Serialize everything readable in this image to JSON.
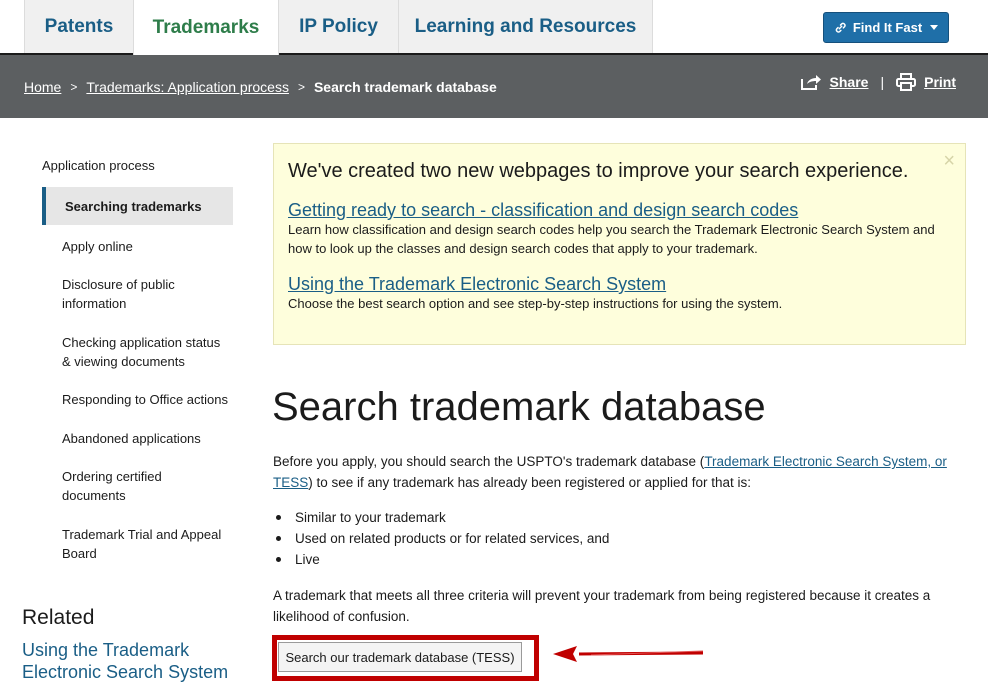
{
  "topnav": {
    "tabs": [
      {
        "label": "Patents"
      },
      {
        "label": "Trademarks"
      },
      {
        "label": "IP Policy"
      },
      {
        "label": "Learning and Resources"
      }
    ],
    "find_it_fast": "Find It Fast",
    "colors": {
      "active_tab": "#2e7d4a",
      "tab_text": "#1a5e86",
      "button": "#1f6fa8"
    }
  },
  "breadcrumb": {
    "items": [
      "Home",
      "Trademarks: Application process"
    ],
    "current": "Search trademark database",
    "share": "Share",
    "print": "Print",
    "divider": "|"
  },
  "sidebar": {
    "heading": "Application process",
    "active": "Searching trademarks",
    "items": [
      {
        "label": "Apply online"
      },
      {
        "label": "Disclosure of public information"
      },
      {
        "label": "Checking application status & viewing documents"
      },
      {
        "label": "Responding to Office actions"
      },
      {
        "label": "Abandoned applications"
      },
      {
        "label": "Ordering certified documents"
      },
      {
        "label": "Trademark Trial and Appeal Board"
      }
    ],
    "related_heading": "Related",
    "related_link": "Using the Trademark Electronic Search System"
  },
  "notice": {
    "title": "We've created two new webpages to improve your search experience.",
    "link1": "Getting ready to search - classification and design search codes",
    "text1": "Learn how classification and design search codes help you search the Trademark Electronic Search System and how to look up the classes and design search codes that apply to your trademark.",
    "link2": "Using the Trademark Electronic Search System",
    "text2": "Choose the best search option and see step-by-step instructions for using the system.",
    "close": "×"
  },
  "main": {
    "title": "Search trademark database",
    "intro_before": "Before you apply, you should search the USPTO's trademark database (",
    "intro_link": "Trademark Electronic Search System, or TESS",
    "intro_after": ") to see if any trademark has already been registered or applied for that is:",
    "bullets": [
      "Similar to your trademark",
      "Used on related products or for related services, and",
      "Live"
    ],
    "para2": "A trademark that meets all three criteria will prevent your trademark from being registered because it creates a likelihood of confusion.",
    "tess_button": "Search our trademark database (TESS)",
    "highlight_color": "#c00000"
  }
}
